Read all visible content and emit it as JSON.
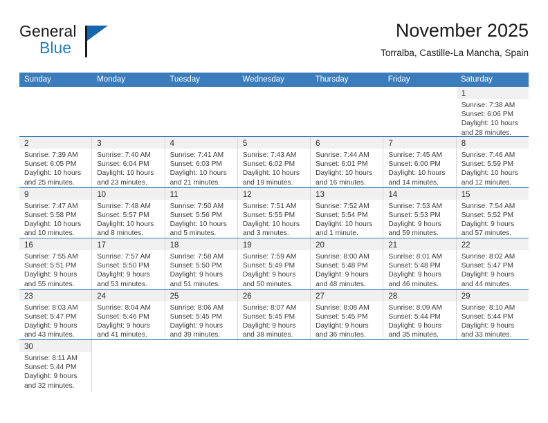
{
  "brand": {
    "name_top": "General",
    "name_bottom": "Blue",
    "accent_color": "#1466ad"
  },
  "header": {
    "month_title": "November 2025",
    "location": "Torralba, Castille-La Mancha, Spain"
  },
  "theme": {
    "header_blue": "#3b7cbd",
    "daynum_band": "#f0f0f0",
    "grid_line": "#d5d5d5"
  },
  "weekdays": [
    "Sunday",
    "Monday",
    "Tuesday",
    "Wednesday",
    "Thursday",
    "Friday",
    "Saturday"
  ],
  "weeks": [
    [
      {
        "empty": true
      },
      {
        "empty": true
      },
      {
        "empty": true
      },
      {
        "empty": true
      },
      {
        "empty": true
      },
      {
        "empty": true
      },
      {
        "day": "1",
        "sunrise": "Sunrise: 7:38 AM",
        "sunset": "Sunset: 6:06 PM",
        "daylight1": "Daylight: 10 hours",
        "daylight2": "and 28 minutes."
      }
    ],
    [
      {
        "day": "2",
        "sunrise": "Sunrise: 7:39 AM",
        "sunset": "Sunset: 6:05 PM",
        "daylight1": "Daylight: 10 hours",
        "daylight2": "and 25 minutes."
      },
      {
        "day": "3",
        "sunrise": "Sunrise: 7:40 AM",
        "sunset": "Sunset: 6:04 PM",
        "daylight1": "Daylight: 10 hours",
        "daylight2": "and 23 minutes."
      },
      {
        "day": "4",
        "sunrise": "Sunrise: 7:41 AM",
        "sunset": "Sunset: 6:03 PM",
        "daylight1": "Daylight: 10 hours",
        "daylight2": "and 21 minutes."
      },
      {
        "day": "5",
        "sunrise": "Sunrise: 7:43 AM",
        "sunset": "Sunset: 6:02 PM",
        "daylight1": "Daylight: 10 hours",
        "daylight2": "and 19 minutes."
      },
      {
        "day": "6",
        "sunrise": "Sunrise: 7:44 AM",
        "sunset": "Sunset: 6:01 PM",
        "daylight1": "Daylight: 10 hours",
        "daylight2": "and 16 minutes."
      },
      {
        "day": "7",
        "sunrise": "Sunrise: 7:45 AM",
        "sunset": "Sunset: 6:00 PM",
        "daylight1": "Daylight: 10 hours",
        "daylight2": "and 14 minutes."
      },
      {
        "day": "8",
        "sunrise": "Sunrise: 7:46 AM",
        "sunset": "Sunset: 5:59 PM",
        "daylight1": "Daylight: 10 hours",
        "daylight2": "and 12 minutes."
      }
    ],
    [
      {
        "day": "9",
        "sunrise": "Sunrise: 7:47 AM",
        "sunset": "Sunset: 5:58 PM",
        "daylight1": "Daylight: 10 hours",
        "daylight2": "and 10 minutes."
      },
      {
        "day": "10",
        "sunrise": "Sunrise: 7:48 AM",
        "sunset": "Sunset: 5:57 PM",
        "daylight1": "Daylight: 10 hours",
        "daylight2": "and 8 minutes."
      },
      {
        "day": "11",
        "sunrise": "Sunrise: 7:50 AM",
        "sunset": "Sunset: 5:56 PM",
        "daylight1": "Daylight: 10 hours",
        "daylight2": "and 5 minutes."
      },
      {
        "day": "12",
        "sunrise": "Sunrise: 7:51 AM",
        "sunset": "Sunset: 5:55 PM",
        "daylight1": "Daylight: 10 hours",
        "daylight2": "and 3 minutes."
      },
      {
        "day": "13",
        "sunrise": "Sunrise: 7:52 AM",
        "sunset": "Sunset: 5:54 PM",
        "daylight1": "Daylight: 10 hours",
        "daylight2": "and 1 minute."
      },
      {
        "day": "14",
        "sunrise": "Sunrise: 7:53 AM",
        "sunset": "Sunset: 5:53 PM",
        "daylight1": "Daylight: 9 hours",
        "daylight2": "and 59 minutes."
      },
      {
        "day": "15",
        "sunrise": "Sunrise: 7:54 AM",
        "sunset": "Sunset: 5:52 PM",
        "daylight1": "Daylight: 9 hours",
        "daylight2": "and 57 minutes."
      }
    ],
    [
      {
        "day": "16",
        "sunrise": "Sunrise: 7:55 AM",
        "sunset": "Sunset: 5:51 PM",
        "daylight1": "Daylight: 9 hours",
        "daylight2": "and 55 minutes."
      },
      {
        "day": "17",
        "sunrise": "Sunrise: 7:57 AM",
        "sunset": "Sunset: 5:50 PM",
        "daylight1": "Daylight: 9 hours",
        "daylight2": "and 53 minutes."
      },
      {
        "day": "18",
        "sunrise": "Sunrise: 7:58 AM",
        "sunset": "Sunset: 5:50 PM",
        "daylight1": "Daylight: 9 hours",
        "daylight2": "and 51 minutes."
      },
      {
        "day": "19",
        "sunrise": "Sunrise: 7:59 AM",
        "sunset": "Sunset: 5:49 PM",
        "daylight1": "Daylight: 9 hours",
        "daylight2": "and 50 minutes."
      },
      {
        "day": "20",
        "sunrise": "Sunrise: 8:00 AM",
        "sunset": "Sunset: 5:48 PM",
        "daylight1": "Daylight: 9 hours",
        "daylight2": "and 48 minutes."
      },
      {
        "day": "21",
        "sunrise": "Sunrise: 8:01 AM",
        "sunset": "Sunset: 5:48 PM",
        "daylight1": "Daylight: 9 hours",
        "daylight2": "and 46 minutes."
      },
      {
        "day": "22",
        "sunrise": "Sunrise: 8:02 AM",
        "sunset": "Sunset: 5:47 PM",
        "daylight1": "Daylight: 9 hours",
        "daylight2": "and 44 minutes."
      }
    ],
    [
      {
        "day": "23",
        "sunrise": "Sunrise: 8:03 AM",
        "sunset": "Sunset: 5:47 PM",
        "daylight1": "Daylight: 9 hours",
        "daylight2": "and 43 minutes."
      },
      {
        "day": "24",
        "sunrise": "Sunrise: 8:04 AM",
        "sunset": "Sunset: 5:46 PM",
        "daylight1": "Daylight: 9 hours",
        "daylight2": "and 41 minutes."
      },
      {
        "day": "25",
        "sunrise": "Sunrise: 8:06 AM",
        "sunset": "Sunset: 5:45 PM",
        "daylight1": "Daylight: 9 hours",
        "daylight2": "and 39 minutes."
      },
      {
        "day": "26",
        "sunrise": "Sunrise: 8:07 AM",
        "sunset": "Sunset: 5:45 PM",
        "daylight1": "Daylight: 9 hours",
        "daylight2": "and 38 minutes."
      },
      {
        "day": "27",
        "sunrise": "Sunrise: 8:08 AM",
        "sunset": "Sunset: 5:45 PM",
        "daylight1": "Daylight: 9 hours",
        "daylight2": "and 36 minutes."
      },
      {
        "day": "28",
        "sunrise": "Sunrise: 8:09 AM",
        "sunset": "Sunset: 5:44 PM",
        "daylight1": "Daylight: 9 hours",
        "daylight2": "and 35 minutes."
      },
      {
        "day": "29",
        "sunrise": "Sunrise: 8:10 AM",
        "sunset": "Sunset: 5:44 PM",
        "daylight1": "Daylight: 9 hours",
        "daylight2": "and 33 minutes."
      }
    ],
    [
      {
        "day": "30",
        "sunrise": "Sunrise: 8:11 AM",
        "sunset": "Sunset: 5:44 PM",
        "daylight1": "Daylight: 9 hours",
        "daylight2": "and 32 minutes."
      },
      {
        "empty": true
      },
      {
        "empty": true
      },
      {
        "empty": true
      },
      {
        "empty": true
      },
      {
        "empty": true
      },
      {
        "empty": true
      }
    ]
  ]
}
